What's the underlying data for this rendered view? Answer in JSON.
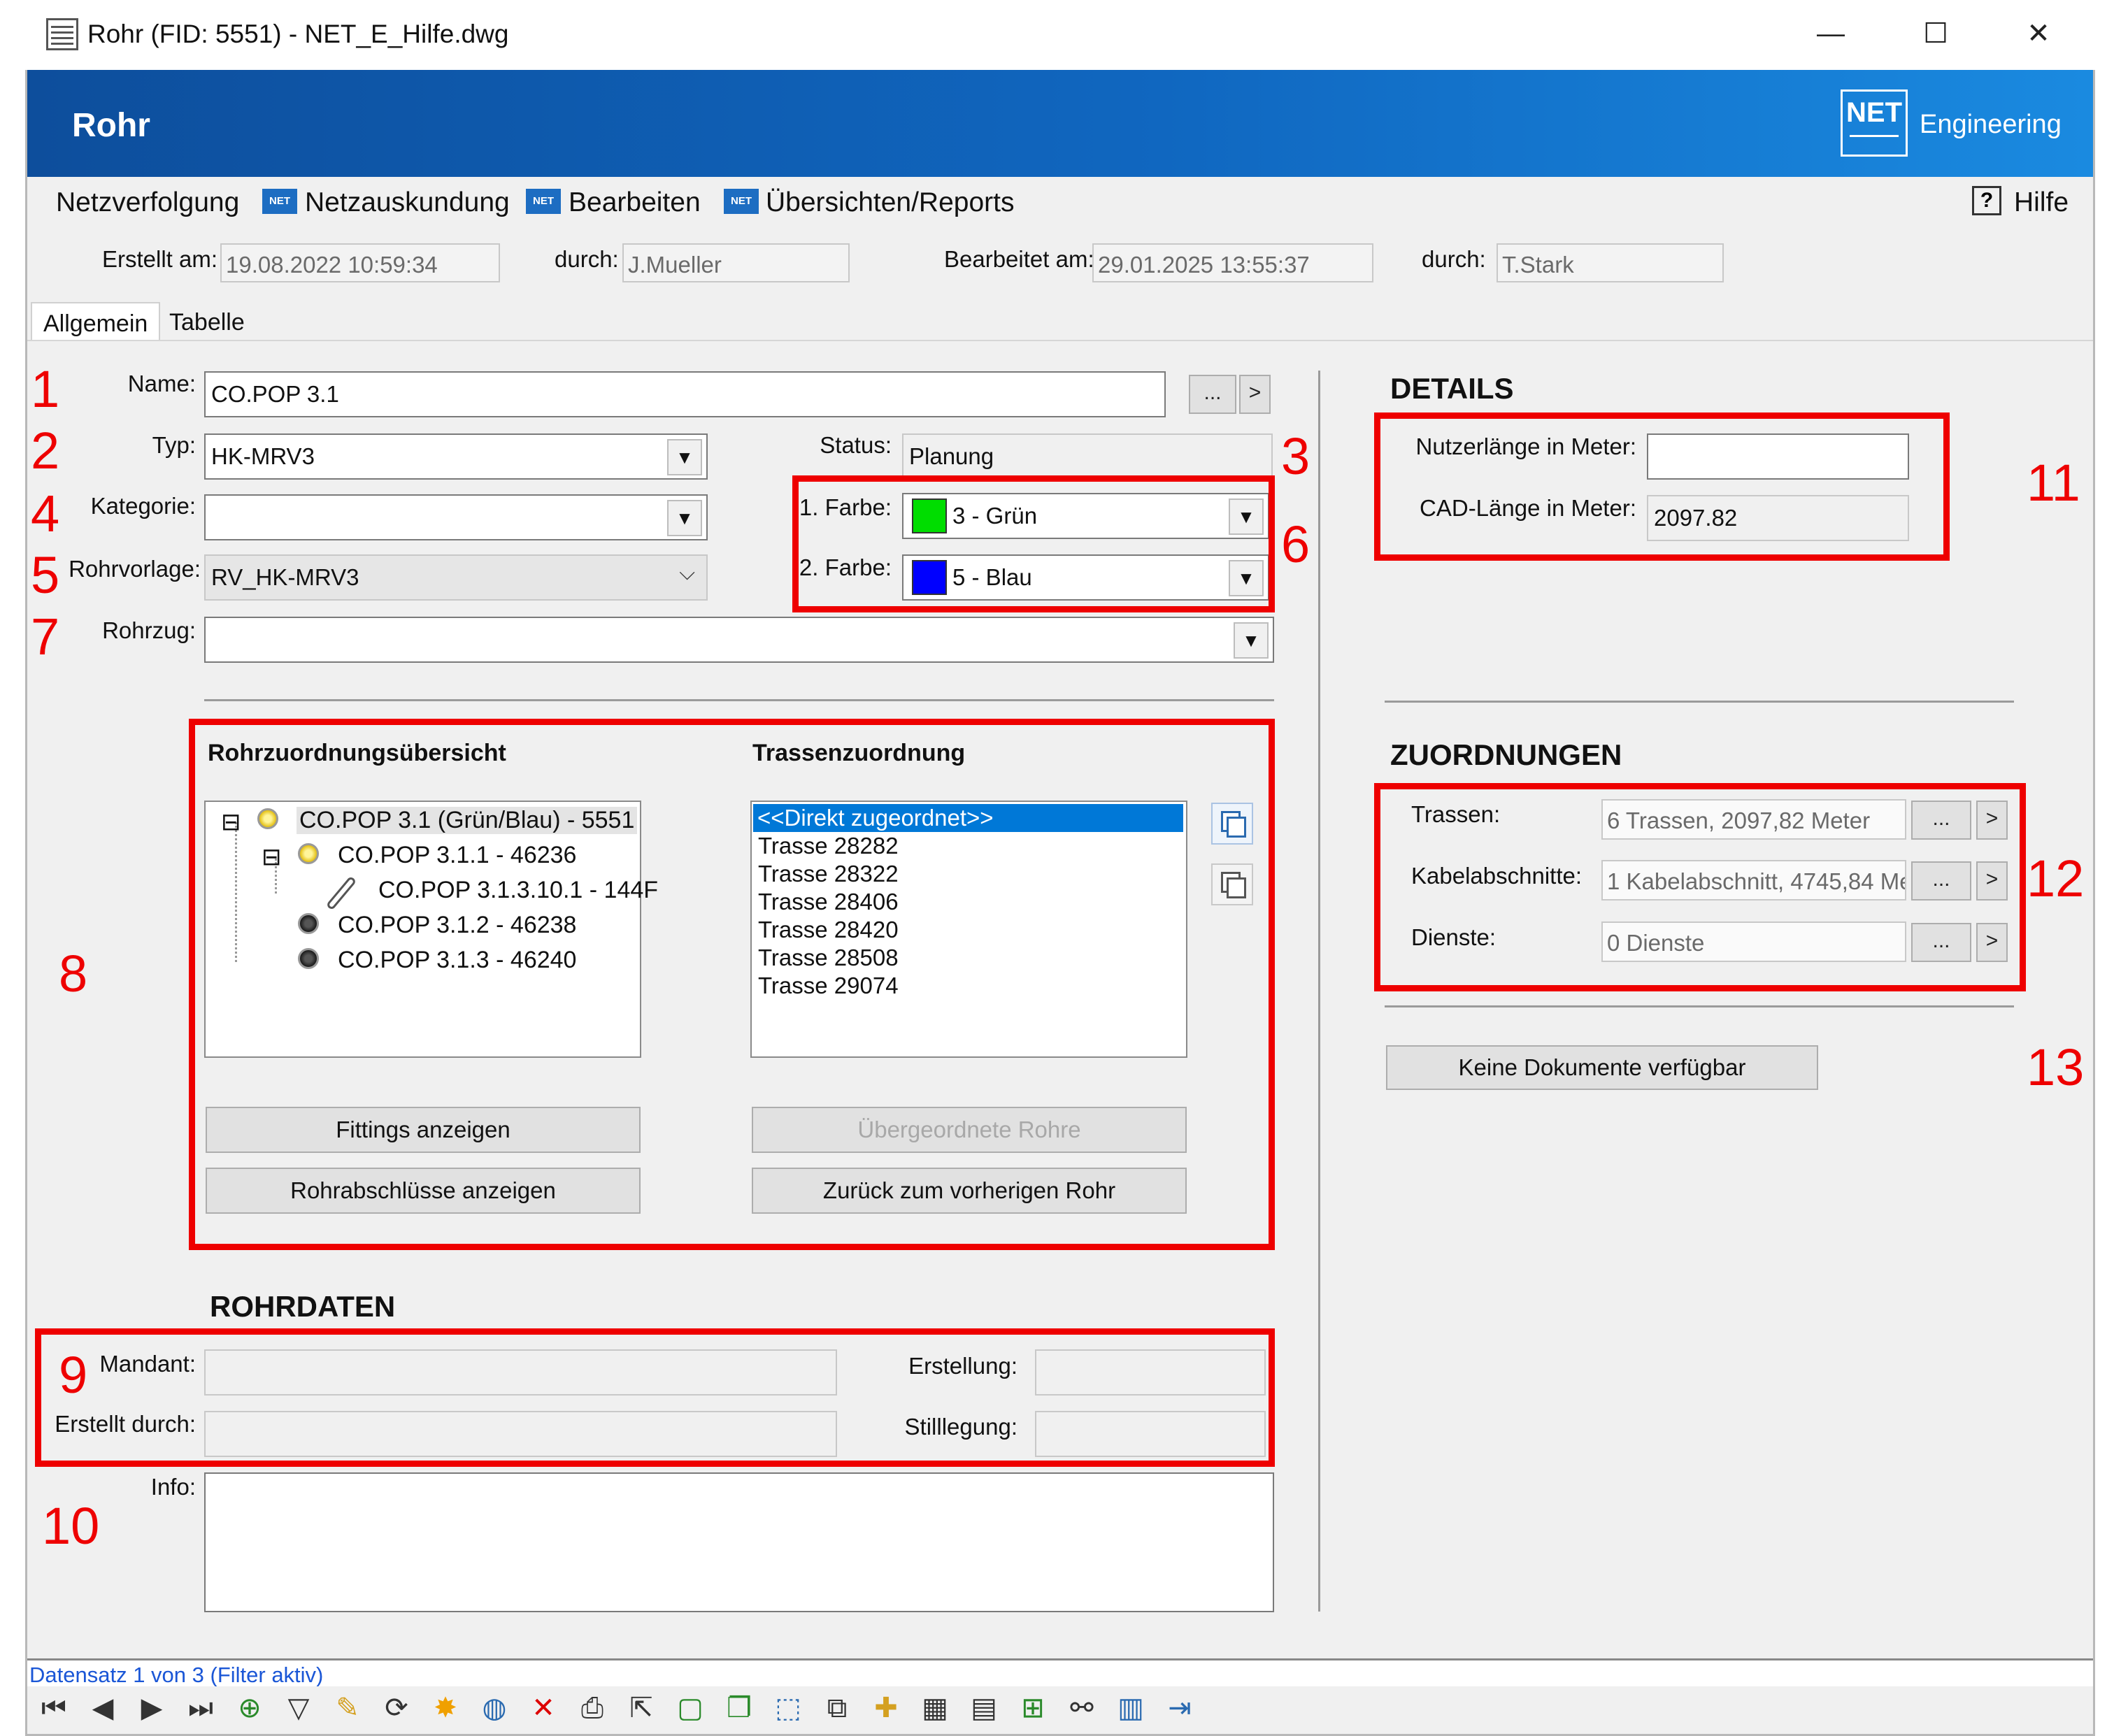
{
  "window": {
    "title": "Rohr (FID: 5551) - NET_E_Hilfe.dwg",
    "minimize": "—",
    "maximize": "☐",
    "close": "✕"
  },
  "header": {
    "title": "Rohr",
    "logo_text": "NET",
    "logo_caption": "Engineering"
  },
  "menu": {
    "items": [
      "Netzverfolgung",
      "Netzauskundung",
      "Bearbeiten",
      "Übersichten/Reports"
    ],
    "net_badge": "NET",
    "help": "Hilfe",
    "help_icon": "?"
  },
  "meta": {
    "created_label": "Erstellt am:",
    "created_value": "19.08.2022 10:59:34",
    "created_by_label": "durch:",
    "created_by_value": "J.Mueller",
    "edited_label": "Bearbeitet am:",
    "edited_value": "29.01.2025 13:55:37",
    "edited_by_label": "durch:",
    "edited_by_value": "T.Stark"
  },
  "tabs": [
    "Allgemein",
    "Tabelle"
  ],
  "form": {
    "name_label": "Name:",
    "name_value": "CO.POP 3.1",
    "dots": "...",
    "arrow": ">",
    "typ_label": "Typ:",
    "typ_value": "HK-MRV3",
    "status_label": "Status:",
    "status_value": "Planung",
    "kategorie_label": "Kategorie:",
    "kategorie_value": "",
    "farbe1_label": "1. Farbe:",
    "farbe1_value": "3 - Grün",
    "farbe1_color": "#00dd00",
    "farbe2_label": "2. Farbe:",
    "farbe2_value": "5 - Blau",
    "farbe2_color": "#0000ff",
    "rohrvorlage_label": "Rohrvorlage:",
    "rohrvorlage_value": "RV_HK-MRV3",
    "rohrzug_label": "Rohrzug:",
    "rohrzug_value": "",
    "dropdown_glyph": "▼",
    "chevron_glyph": "⌵"
  },
  "overview": {
    "title": "Rohrzuordnungsübersicht",
    "tree": [
      {
        "label": "CO.POP 3.1 (Grün/Blau) - 5551",
        "expander": "⊟"
      },
      {
        "label": "CO.POP 3.1.1 - 46236",
        "expander": "⊟"
      },
      {
        "label": "CO.POP 3.1.3.10.1 - 144F"
      },
      {
        "label": "CO.POP 3.1.2 - 46238"
      },
      {
        "label": "CO.POP 3.1.3 - 46240"
      }
    ],
    "trassen_title": "Trassenzuordnung",
    "trassen": [
      "<<Direkt zugeordnet>>",
      "Trasse 28282",
      "Trasse 28322",
      "Trasse 28406",
      "Trasse 28420",
      "Trasse 28508",
      "Trasse 29074"
    ],
    "btn_fittings": "Fittings anzeigen",
    "btn_abschluesse": "Rohrabschlüsse anzeigen",
    "btn_uebergeordnet": "Übergeordnete Rohre",
    "btn_zurueck": "Zurück zum vorherigen Rohr"
  },
  "rohrdaten": {
    "title": "ROHRDATEN",
    "mandant_label": "Mandant:",
    "mandant_value": "",
    "erstellt_durch_label": "Erstellt durch:",
    "erstellt_durch_value": "",
    "erstellung_label": "Erstellung:",
    "erstellung_value": "",
    "stilllegung_label": "Stilllegung:",
    "stilllegung_value": "",
    "info_label": "Info:",
    "info_value": ""
  },
  "details": {
    "title": "DETAILS",
    "nutzer_label": "Nutzerlänge in Meter:",
    "nutzer_value": "",
    "cad_label": "CAD-Länge in Meter:",
    "cad_value": "2097.82"
  },
  "zuordnungen": {
    "title": "ZUORDNUNGEN",
    "trassen_label": "Trassen:",
    "trassen_value": "6 Trassen, 2097,82 Meter",
    "kabel_label": "Kabelabschnitte:",
    "kabel_value": "1 Kabelabschnitt, 4745,84 Me",
    "dienste_label": "Dienste:",
    "dienste_value": "0 Dienste",
    "dokumente_btn": "Keine Dokumente verfügbar"
  },
  "annotations": [
    "1",
    "2",
    "3",
    "4",
    "5",
    "6",
    "7",
    "8",
    "9",
    "10",
    "11",
    "12",
    "13"
  ],
  "statusbar": {
    "text": "Datensatz 1 von 3 (Filter aktiv)"
  },
  "toolbar": {
    "icons": [
      "first-record-icon",
      "prev-record-icon",
      "next-record-icon",
      "last-record-icon",
      "add-filter-icon",
      "filter-icon",
      "edit-pencil-icon",
      "refresh-icon",
      "highlight-icon",
      "zoom-globe-icon",
      "delete-icon",
      "print-icon",
      "select-icon",
      "copy-icon",
      "copy-multi-icon",
      "select-frame-icon",
      "duplicate-icon",
      "new-folder-icon",
      "doc-60-icon",
      "doc-icon",
      "doc-add-icon",
      "network-icon",
      "table-export-icon",
      "exit-icon"
    ],
    "glyphs": [
      "⏮",
      "◀",
      "▶",
      "⏭",
      "⊕",
      "▽",
      "✎",
      "⟳",
      "✸",
      "◍",
      "✕",
      "⎙",
      "⇱",
      "▢",
      "❐",
      "⬚",
      "⧉",
      "✚",
      "▦",
      "▤",
      "⊞",
      "⚯",
      "▥",
      "⇥"
    ],
    "colors": [
      "#333",
      "#333",
      "#333",
      "#333",
      "#2a8a2a",
      "#333",
      "#d4a020",
      "#333",
      "#f0a000",
      "#2a6ab0",
      "#dd0000",
      "#333",
      "#333",
      "#2a8a2a",
      "#2a8a2a",
      "#2a6ab0",
      "#333",
      "#d4a020",
      "#333",
      "#333",
      "#2a8a2a",
      "#333",
      "#2a6ab0",
      "#2a6ab0"
    ]
  },
  "colors": {
    "accent": "#1067c0",
    "annotation_red": "#ee0000",
    "link_blue": "#1a56d6",
    "selection": "#0078d7"
  }
}
